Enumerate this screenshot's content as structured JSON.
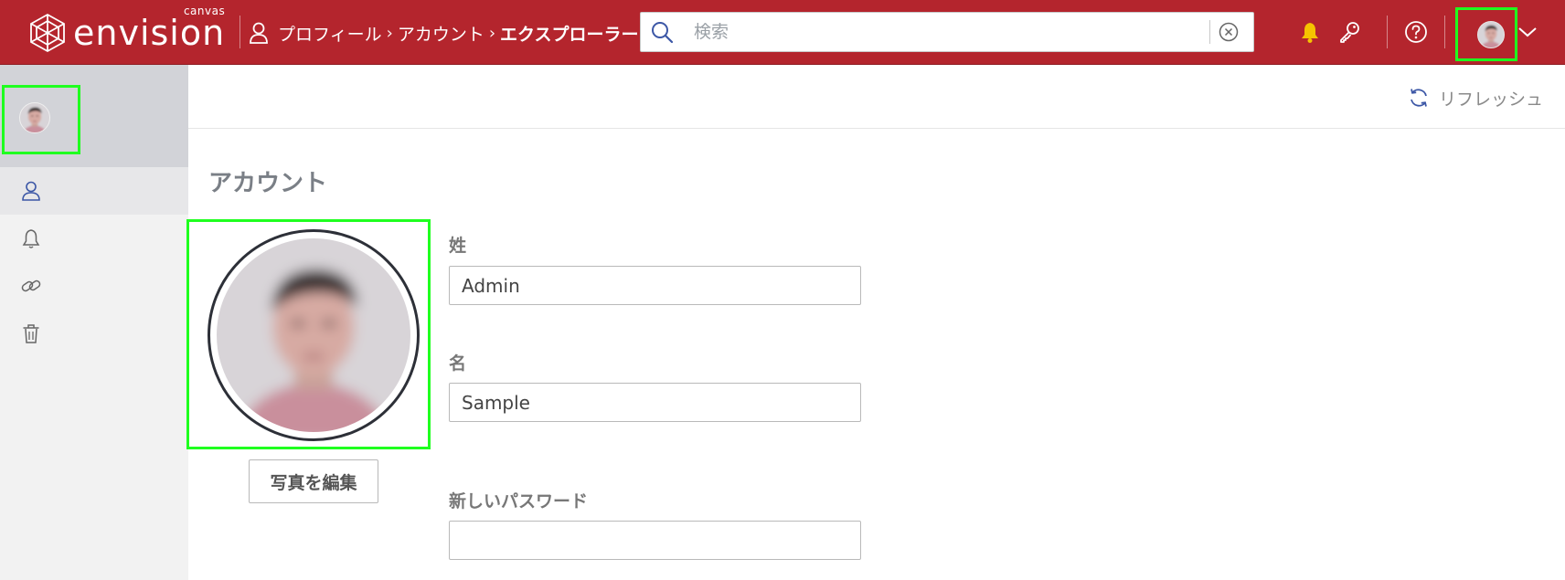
{
  "header": {
    "logo_text": "envision",
    "logo_sub": "canvas",
    "breadcrumb": [
      "プロフィール",
      "アカウント",
      "エクスプローラー"
    ],
    "search_placeholder": "検索",
    "icons": [
      "bell-icon",
      "key-icon",
      "help-icon",
      "avatar",
      "chevron-down-icon"
    ],
    "bell_color": "#f5c400"
  },
  "toolbar": {
    "refresh_label": "リフレッシュ"
  },
  "sidebar": {
    "items": [
      {
        "icon": "user-icon",
        "active": true
      },
      {
        "icon": "bell-icon",
        "active": false
      },
      {
        "icon": "link-icon",
        "active": false
      },
      {
        "icon": "trash-icon",
        "active": false
      }
    ]
  },
  "main": {
    "title": "アカウント",
    "edit_photo_label": "写真を編集",
    "fields": {
      "last_name": {
        "label": "姓",
        "value": "Admin"
      },
      "first_name": {
        "label": "名",
        "value": "Sample"
      },
      "new_password": {
        "label": "新しいパスワード",
        "value": ""
      }
    }
  },
  "colors": {
    "header_bg": "#b4252d",
    "highlight": "#1fff1f",
    "sidebar_bg": "#f2f2f2",
    "sidebar_head_bg": "#d2d3d8"
  }
}
